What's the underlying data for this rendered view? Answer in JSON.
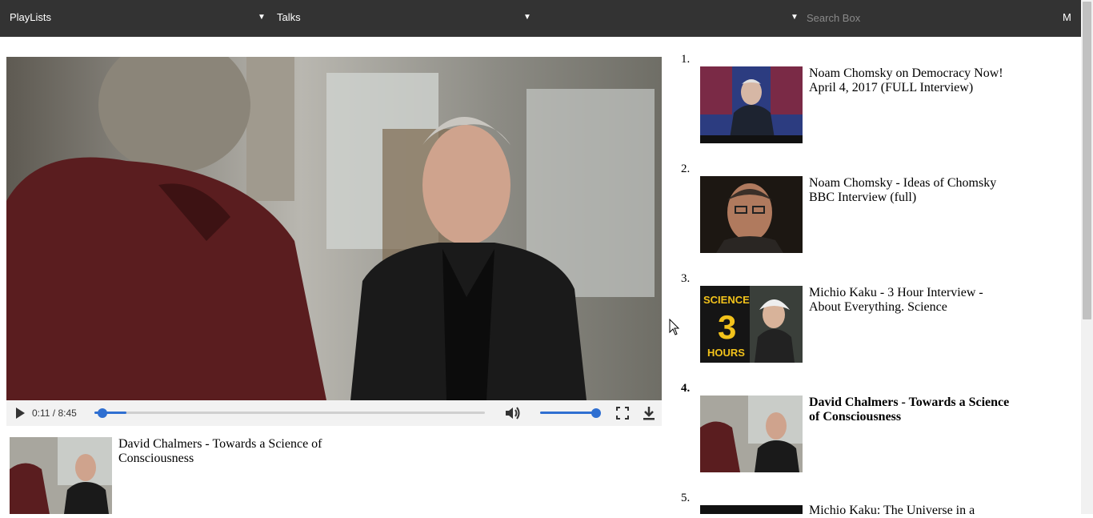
{
  "topbar": {
    "playlists_label": "PlayLists",
    "talks_label": "Talks",
    "search_placeholder": "Search Box",
    "menu_label": "M"
  },
  "player": {
    "time_text": "0:11 / 8:45",
    "progress_fraction": 0.021,
    "volume_fraction": 1.0
  },
  "now_playing": {
    "title": "David Chalmers - Towards a Science of Consciousness"
  },
  "playlist": [
    {
      "number": "1.",
      "title": "Noam Chomsky on Democracy Now! April 4, 2017 (FULL Interview)",
      "active": false
    },
    {
      "number": "2.",
      "title": "Noam Chomsky - Ideas of Chomsky BBC Interview (full)",
      "active": false
    },
    {
      "number": "3.",
      "title": "Michio Kaku - 3 Hour Interview - About Everything. Science",
      "active": false,
      "thumb_text_1": "SCIENCE",
      "thumb_text_2": "3",
      "thumb_text_3": "HOURS"
    },
    {
      "number": "4.",
      "title": "David Chalmers - Towards a Science of Consciousness",
      "active": true
    },
    {
      "number": "5.",
      "title": "Michio Kaku: The Universe in a",
      "active": false
    }
  ],
  "colors": {
    "topbar": "#333333",
    "accent": "#2f6fd1"
  }
}
